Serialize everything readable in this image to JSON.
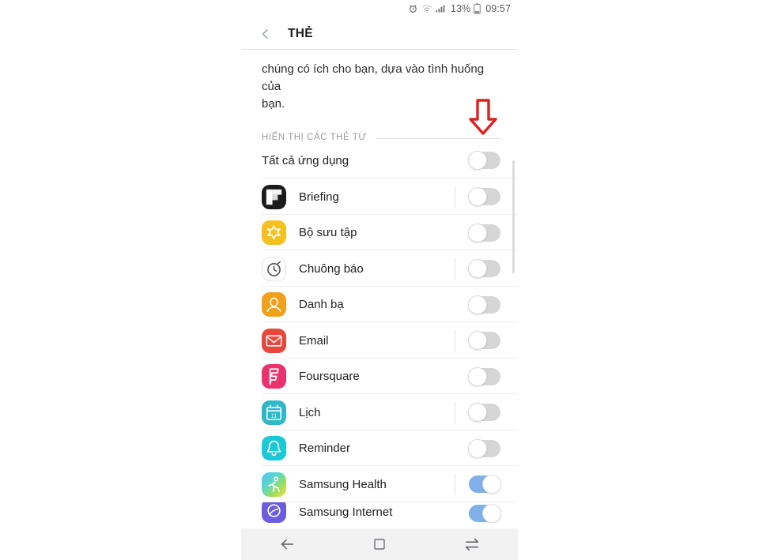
{
  "status_bar": {
    "alarm_icon": "alarm-clock-icon",
    "wifi_icon": "wifi-icon",
    "signal_icon": "cellular-signal-icon",
    "battery_percent": "13%",
    "battery_icon": "battery-icon",
    "time": "09:57"
  },
  "header": {
    "back_icon": "back-chevron-icon",
    "title": "THẺ"
  },
  "intro": {
    "line1": "chúng có ích cho bạn, dựa vào tình huống của",
    "line2": "bạn."
  },
  "section": {
    "label": "HIỂN THỊ CÁC THẺ TỪ"
  },
  "master_row": {
    "label": "Tất cả ứng dụng",
    "toggle_state": "off"
  },
  "apps": [
    {
      "label": "Briefing",
      "icon_name": "flipboard-briefing-icon",
      "icon_bg": "#1b1b1b",
      "toggle_state": "off"
    },
    {
      "label": "Bộ sưu tập",
      "icon_name": "gallery-flower-icon",
      "icon_bg": "#f5c020",
      "toggle_state": "off"
    },
    {
      "label": "Chuông báo",
      "icon_name": "alarm-clock-app-icon",
      "icon_bg": "#fdfdfd",
      "toggle_state": "off"
    },
    {
      "label": "Danh bạ",
      "icon_name": "contacts-person-icon",
      "icon_bg": "#f0a11c",
      "toggle_state": "off"
    },
    {
      "label": "Email",
      "icon_name": "email-envelope-icon",
      "icon_bg": "#e8483c",
      "toggle_state": "off"
    },
    {
      "label": "Foursquare",
      "icon_name": "foursquare-icon",
      "icon_bg": "#e8336d",
      "toggle_state": "off"
    },
    {
      "label": "Lịch",
      "icon_name": "calendar-icon",
      "icon_bg": "#30b7c8",
      "toggle_state": "off"
    },
    {
      "label": "Reminder",
      "icon_name": "reminder-bell-icon",
      "icon_bg": "#1fc8d8",
      "toggle_state": "off"
    },
    {
      "label": "Samsung Health",
      "icon_name": "samsung-health-runner-icon",
      "icon_bg": "gradient",
      "toggle_state": "on"
    },
    {
      "label": "Samsung Internet",
      "icon_name": "samsung-internet-icon",
      "icon_bg": "#6b5ce0",
      "toggle_state": "on"
    }
  ],
  "nav_bar": {
    "back": "nav-back-icon",
    "home": "nav-home-icon",
    "recents": "nav-recents-icon"
  },
  "annotation": {
    "arrow": "red-down-arrow",
    "color": "#e02020"
  },
  "colors": {
    "toggle_on": "#7fb0ea",
    "toggle_off": "#d6d6d6",
    "divider": "#ededed",
    "section_label": "#9b9b9b"
  }
}
